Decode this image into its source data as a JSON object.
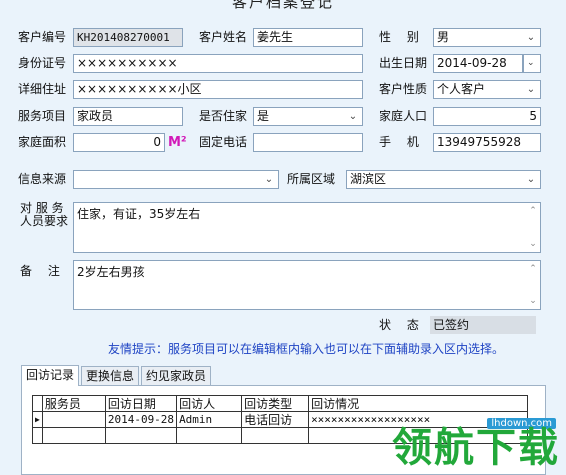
{
  "window": {
    "title": "客户档案登记"
  },
  "form": {
    "customer_no_label": "客户编号",
    "customer_no": "KH201408270001",
    "customer_name_label": "客户姓名",
    "customer_name": "姜先生",
    "gender_label": "性　 别",
    "gender": "男",
    "id_label": "身份证号",
    "id_value": "××××××××××",
    "birth_label": "出生日期",
    "birth_value": "2014-09-28",
    "address_label": "详细住址",
    "address_value": "××××××××××小区",
    "nature_label": "客户性质",
    "nature_value": "个人客户",
    "service_label": "服务项目",
    "service_value": "家政员",
    "live_label": "是否住家",
    "live_value": "是",
    "family_label": "家庭人口",
    "family_value": "5",
    "area_label": "家庭面积",
    "area_value": "0",
    "area_unit": "M²",
    "phone_label": "固定电话",
    "phone_value": "",
    "mobile_label": "手　 机",
    "mobile_value": "13949755928",
    "source_label": "信息来源",
    "source_value": "",
    "region_label": "所属区域",
    "region_value": "湖滨区",
    "req_label_1": "对 服 务",
    "req_label_2": "人员要求",
    "req_value": "住家，有证，35岁左右",
    "note_label": "备　 注",
    "note_value": "2岁左右男孩",
    "status_label": "状　 态",
    "status_value": "已签约",
    "hint": "友情提示：服务项目可以在编辑框内输入也可以在下面辅助录入区内选择。"
  },
  "tabs": [
    {
      "label": "回访记录"
    },
    {
      "label": "更换信息"
    },
    {
      "label": "约见家政员"
    }
  ],
  "grid": {
    "columns": [
      "服务员",
      "回访日期",
      "回访人",
      "回访类型",
      "回访情况"
    ],
    "rows": [
      [
        "",
        "2014-09-28",
        "Admin",
        "电话回访",
        "××××××××××××××××××"
      ]
    ]
  },
  "watermark": {
    "text": "领航下载",
    "url": "lhdown.com"
  },
  "icons": {
    "dropdown": "chevron-down-icon",
    "spin": "spin-arrows-icon",
    "row_pointer": "row-pointer-icon"
  }
}
